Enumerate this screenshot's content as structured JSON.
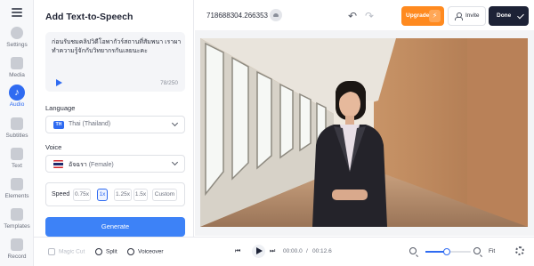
{
  "nav": {
    "items": [
      {
        "label": "Settings",
        "icon": "gear-icon"
      },
      {
        "label": "Media",
        "icon": "plus-icon"
      },
      {
        "label": "Audio",
        "icon": "music-note-icon",
        "active": true
      },
      {
        "label": "Subtitles",
        "icon": "subtitles-icon"
      },
      {
        "label": "Text",
        "icon": "text-icon"
      },
      {
        "label": "Elements",
        "icon": "shapes-icon"
      },
      {
        "label": "Templates",
        "icon": "templates-icon"
      },
      {
        "label": "Record",
        "icon": "record-icon"
      }
    ]
  },
  "panel": {
    "title": "Add Text-to-Speech",
    "text": "ก่อนรับชมคลิปวิดีโอพากัวร์สถานที่สัมพนา เราผาทำความรู้จักกับวิทยากรกันเลยนะคะ",
    "counter": "78/250",
    "language_label": "Language",
    "language_badge": "TH",
    "language_value": "Thai (Thailand)",
    "voice_label": "Voice",
    "voice_name": "อัจฉรา",
    "voice_gender": "(Female)",
    "speed_label": "Speed",
    "speeds": [
      "0.75x",
      "1x",
      "1.25x",
      "1.5x",
      "Custom"
    ],
    "speed_selected": "1x",
    "generate_label": "Generate"
  },
  "topbar": {
    "project_id": "718688304.266353",
    "upgrade_label": "Upgrade",
    "invite_label": "Invite",
    "done_label": "Done"
  },
  "bottom": {
    "magic_cut": "Magic Cut",
    "split": "Split",
    "voiceover": "Voiceover",
    "time_current": "00:00.0",
    "time_separator": "/",
    "time_total": "00:12.6",
    "fit_label": "Fit",
    "zoom_fraction": 0.48
  },
  "colors": {
    "accent": "#2f6bf1",
    "generate": "#3d82f7",
    "upgrade": "#ff8a1f",
    "done": "#1d2236"
  }
}
